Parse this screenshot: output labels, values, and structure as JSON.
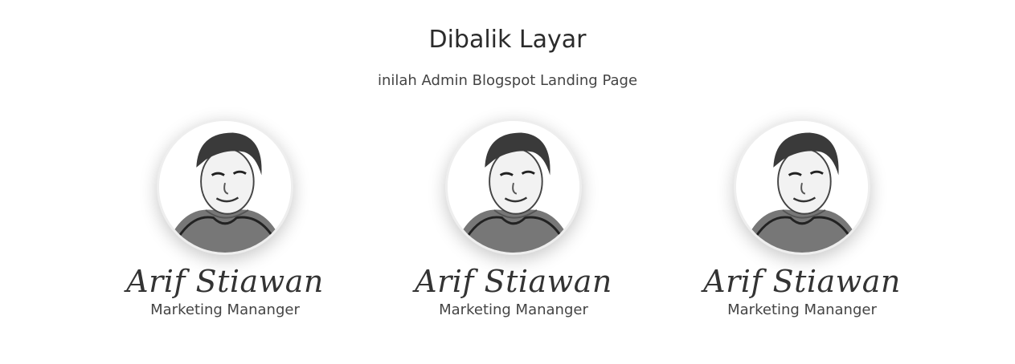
{
  "header": {
    "title": "Dibalik Layar",
    "subtitle": "inilah Admin Blogspot Landing Page"
  },
  "team": [
    {
      "name": "Arif Stiawan",
      "role": "Marketing Mananger"
    },
    {
      "name": "Arif Stiawan",
      "role": "Marketing Mananger"
    },
    {
      "name": "Arif Stiawan",
      "role": "Marketing Mananger"
    }
  ]
}
